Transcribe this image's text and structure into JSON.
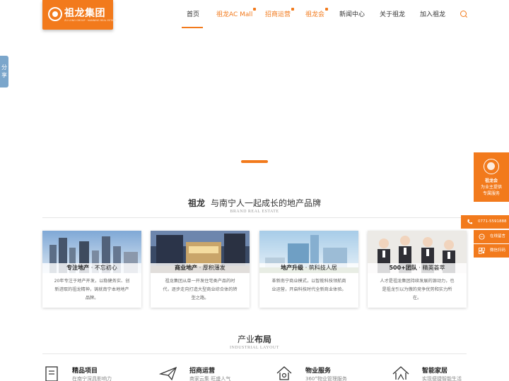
{
  "brand": {
    "name": "祖龙集团",
    "tagline": "ZU LONG GROUP · NANNING REAL ESTATE"
  },
  "nav": {
    "items": [
      {
        "label": "首页"
      },
      {
        "label": "祖龙AC Mall"
      },
      {
        "label": "招商运营"
      },
      {
        "label": "祖龙会"
      },
      {
        "label": "新闻中心"
      },
      {
        "label": "关于祖龙"
      },
      {
        "label": "加入祖龙"
      }
    ]
  },
  "share": {
    "label": "分享"
  },
  "brand_section": {
    "title_bold": "祖龙",
    "title_rest": "与南宁人一起成长的地产品牌",
    "subtitle": "BRAND REAL ESTATE"
  },
  "cards": [
    {
      "title_bold": "专注地产",
      "title_rest": " · 不忘初心",
      "desc": "20年专注于地产开发，以稳健务实、创新进取的祖龙精神，铸就南宁本地地产品牌。"
    },
    {
      "title_bold": "商业地产",
      "title_rest": " · 厚积薄发",
      "desc": "祖龙集团从单一开发住宅类产品的时代，逐步走向打造大型商业综合体的转型之路。"
    },
    {
      "title_bold": "地产升级",
      "title_rest": " · 筑科技人居",
      "desc": "革新南宁商业模式，以智能科技领航商业运营，开启科技时代全新商业体验。"
    },
    {
      "title_bold": "500+团队",
      "title_rest": " · 精英荟萃",
      "desc": "人才是祖龙集团持续发展的源动力，也是祖龙引以为傲的竞争优势和实力所在。"
    }
  ],
  "industry_section": {
    "title_rest": "产业",
    "title_bold": "布局",
    "subtitle": "INDUSTRIAL LAYOUT",
    "items": [
      {
        "name": "精品项目",
        "desc": "在南宁深具影响力",
        "icon": "document-icon"
      },
      {
        "name": "招商运营",
        "desc": "商家云集 旺盛人气",
        "icon": "paper-plane-icon"
      },
      {
        "name": "物业服务",
        "desc": "360°物业管理服务",
        "icon": "house-hand-icon"
      },
      {
        "name": "智能家居",
        "desc": "实现便捷智能生活",
        "icon": "smart-home-icon"
      }
    ]
  },
  "float_panel": {
    "club_name": "祖龙会",
    "club_line1": "为业主提供",
    "club_line2": "专属服务",
    "phone": "0771-5591888",
    "message": "在线留言",
    "wechat": "微信扫码"
  },
  "colors": {
    "accent": "#f27a1c",
    "share": "#7ba6cb"
  }
}
